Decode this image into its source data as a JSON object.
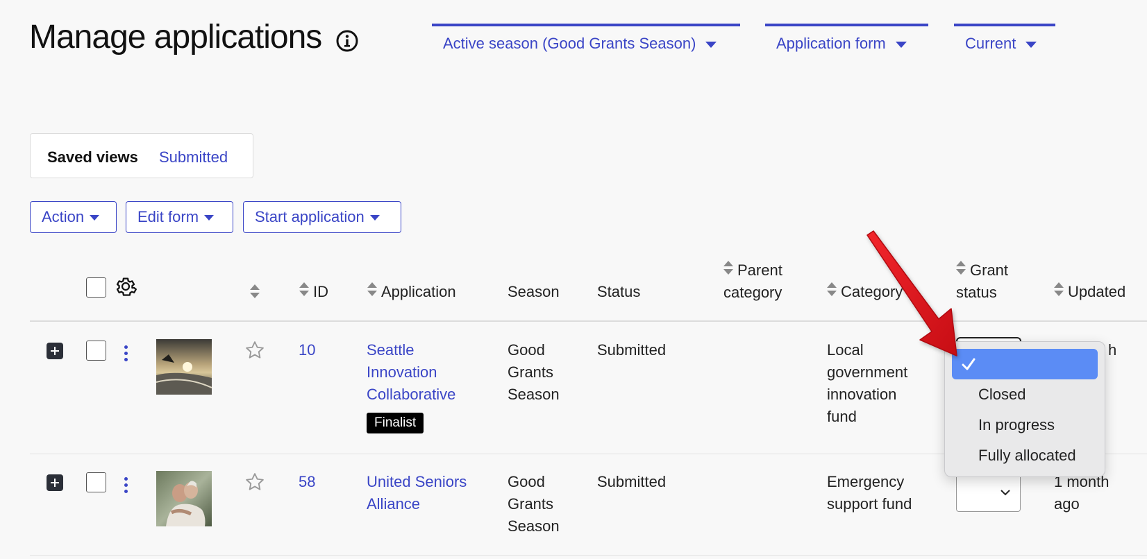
{
  "header": {
    "title": "Manage applications",
    "filters": [
      {
        "label": "Active season (Good Grants Season)"
      },
      {
        "label": "Application form"
      },
      {
        "label": "Current"
      }
    ]
  },
  "saved_views": {
    "label": "Saved views",
    "link": "Submitted"
  },
  "toolbar": {
    "action": "Action",
    "edit_form": "Edit form",
    "start_application": "Start application"
  },
  "table": {
    "columns": {
      "id": "ID",
      "application": "Application",
      "season": "Season",
      "status": "Status",
      "parent_category_line1": "Parent",
      "parent_category_line2": "category",
      "category": "Category",
      "grant_status_line1": "Grant",
      "grant_status_line2": "status",
      "updated": "Updated"
    },
    "rows": [
      {
        "id": "10",
        "application_lines": [
          "Seattle",
          "Innovation",
          "Collaborative"
        ],
        "badge": "Finalist",
        "season_lines": [
          "Good",
          "Grants",
          "Season"
        ],
        "status": "Submitted",
        "category_lines": [
          "Local",
          "government",
          "innovation",
          "fund"
        ],
        "updated_partial": "h"
      },
      {
        "id": "58",
        "application_lines": [
          "United Seniors",
          "Alliance"
        ],
        "season_lines": [
          "Good",
          "Grants",
          "Season"
        ],
        "status": "Submitted",
        "category_lines": [
          "Emergency",
          "support fund"
        ],
        "updated_lines": [
          "1 month",
          "ago"
        ]
      }
    ]
  },
  "grant_status_dropdown": {
    "options": [
      "",
      "Closed",
      "In progress",
      "Fully allocated"
    ],
    "selected_index": 0
  },
  "colors": {
    "accent": "#3a45c6",
    "selected_option": "#5b8cf5",
    "annotation_arrow": "#e8101a"
  },
  "icons": [
    "info-icon",
    "gear-icon",
    "star-icon",
    "expand-icon",
    "kebab-icon",
    "checkmark-icon",
    "chevron-down-icon"
  ]
}
